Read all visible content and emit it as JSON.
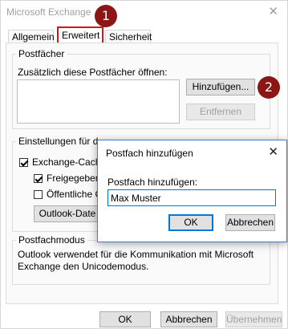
{
  "window": {
    "title": "Microsoft Exchange",
    "close_glyph": "✕"
  },
  "tabs": [
    {
      "label": "Allgemein"
    },
    {
      "label": "Erweitert"
    },
    {
      "label": "Sicherheit"
    }
  ],
  "markers": {
    "one": "1",
    "two": "2",
    "color": "#8c1515"
  },
  "postfaecher": {
    "legend": "Postfächer",
    "label": "Zusätzlich diese Postfächer öffnen:",
    "add_button": "Hinzufügen...",
    "remove_button": "Entfernen"
  },
  "einstellungen": {
    "legend": "Einstellungen für d",
    "cached_mode": {
      "label": "Exchange-Cache",
      "checked": true
    },
    "shared_folders": {
      "label": "Freigegeben",
      "checked": true
    },
    "public_folders": {
      "label": "Öffentliche C",
      "checked": false
    },
    "outlook_data_button": "Outlook-Date"
  },
  "postfachmodus": {
    "legend": "Postfachmodus",
    "text_line1": "Outlook verwendet für die Kommunikation mit Microsoft",
    "text_line2": "Exchange den Unicodemodus."
  },
  "footer": {
    "ok": "OK",
    "cancel": "Abbrechen",
    "apply": "Übernehmen"
  },
  "dialog": {
    "title": "Postfach hinzufügen",
    "close_glyph": "✕",
    "label": "Postfach hinzufügen:",
    "input_value": "Max Muster",
    "ok": "OK",
    "cancel": "Abbrechen"
  },
  "colors": {
    "accent": "#0078d7",
    "highlight": "#cc1a1a"
  }
}
